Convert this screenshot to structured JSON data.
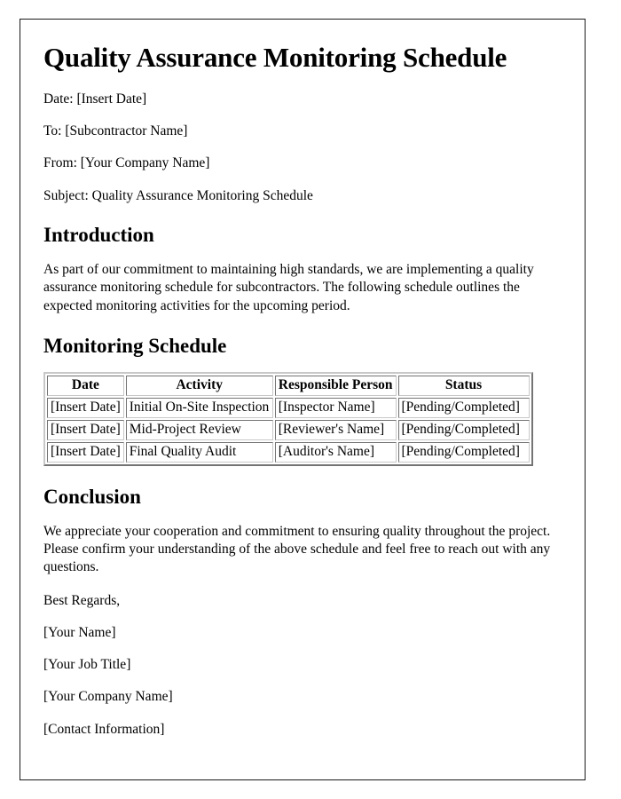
{
  "document": {
    "title": "Quality Assurance Monitoring Schedule",
    "meta": [
      {
        "label": "Date",
        "text": "Date: [Insert Date]"
      },
      {
        "label": "To",
        "text": "To: [Subcontractor Name]"
      },
      {
        "label": "From",
        "text": "From: [Your Company Name]"
      },
      {
        "label": "Subject",
        "text": "Subject: Quality Assurance Monitoring Schedule"
      }
    ],
    "introduction": {
      "heading": "Introduction",
      "paragraph": "As part of our commitment to maintaining high standards, we are implementing a quality assurance monitoring schedule for subcontractors. The following schedule outlines the expected monitoring activities for the upcoming period."
    },
    "schedule": {
      "heading": "Monitoring Schedule",
      "columns": [
        "Date",
        "Activity",
        "Responsible Person",
        "Status"
      ],
      "rows": [
        [
          "[Insert Date]",
          "Initial On-Site Inspection",
          "[Inspector Name]",
          "[Pending/Completed]"
        ],
        [
          "[Insert Date]",
          "Mid-Project Review",
          "[Reviewer's Name]",
          "[Pending/Completed]"
        ],
        [
          "[Insert Date]",
          "Final Quality Audit",
          "[Auditor's Name]",
          "[Pending/Completed]"
        ]
      ]
    },
    "conclusion": {
      "heading": "Conclusion",
      "paragraph": "We appreciate your cooperation and commitment to ensuring quality throughout the project. Please confirm your understanding of the above schedule and feel free to reach out with any questions."
    },
    "signature": [
      "Best Regards,",
      "[Your Name]",
      "[Your Job Title]",
      "[Your Company Name]",
      "[Contact Information]"
    ]
  }
}
